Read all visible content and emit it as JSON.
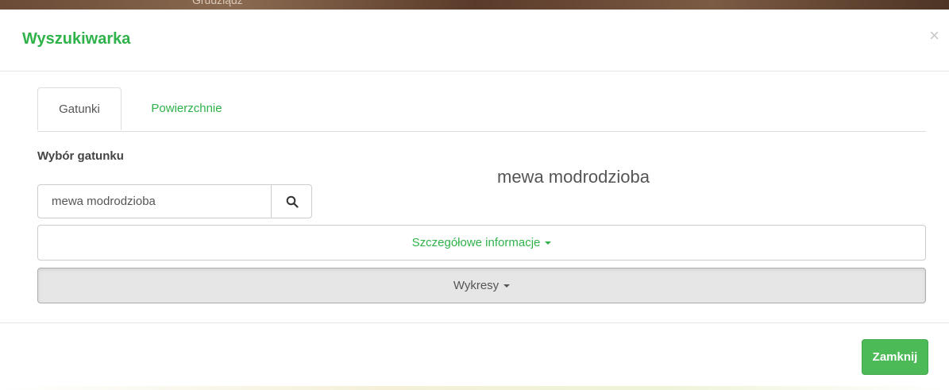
{
  "background": {
    "top_text": "Grudziądz"
  },
  "modal": {
    "title": "Wyszukiwarka",
    "close_symbol": "×",
    "close_icon": "close-icon"
  },
  "tabs": [
    {
      "label": "Gatunki",
      "active": true
    },
    {
      "label": "Powierzchnie",
      "active": false
    }
  ],
  "species_section": {
    "label": "Wybór gatunku",
    "search_value": "mewa modrodzioba",
    "search_icon": "search-icon",
    "selected_species": "mewa modrodzioba"
  },
  "panels": {
    "details_label": "Szczegółowe informacje",
    "charts_label": "Wykresy"
  },
  "footer": {
    "close_label": "Zamknij"
  },
  "colors": {
    "accent_green": "#2fb24a",
    "button_green": "#4cba56"
  }
}
